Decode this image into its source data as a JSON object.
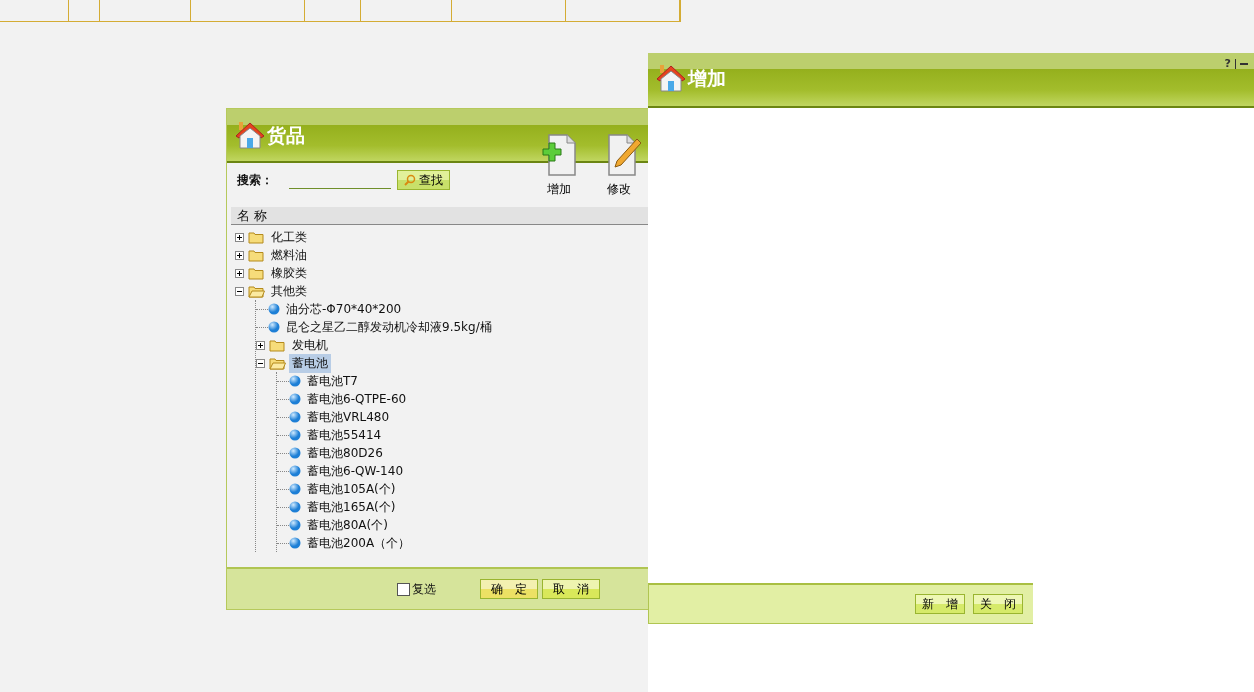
{
  "goods_dialog": {
    "title": "货品",
    "search": {
      "label": "搜索：",
      "button": "查找"
    },
    "toolbar": [
      {
        "label": "增加",
        "kind": "add"
      },
      {
        "label": "修改",
        "kind": "edit"
      }
    ],
    "column": "名 称",
    "tree": [
      {
        "label": "化工类",
        "kind": "folder",
        "expanded": false,
        "selected": false
      },
      {
        "label": "燃料油",
        "kind": "folder",
        "expanded": false,
        "selected": false
      },
      {
        "label": "橡胶类",
        "kind": "folder",
        "expanded": false,
        "selected": false
      },
      {
        "label": "其他类",
        "kind": "folder",
        "expanded": true,
        "selected": false,
        "children": [
          {
            "label": "油分芯-Φ70*40*200",
            "kind": "leaf",
            "selected": false
          },
          {
            "label": "昆仑之星乙二醇发动机冷却液9.5kg/桶",
            "kind": "leaf",
            "selected": false
          },
          {
            "label": "发电机",
            "kind": "folder",
            "expanded": false,
            "selected": false
          },
          {
            "label": "蓄电池",
            "kind": "folder",
            "expanded": true,
            "selected": true,
            "children": [
              {
                "label": "蓄电池T7",
                "kind": "leaf",
                "selected": false
              },
              {
                "label": "蓄电池6-QTPE-60",
                "kind": "leaf",
                "selected": false
              },
              {
                "label": "蓄电池VRL480",
                "kind": "leaf",
                "selected": false
              },
              {
                "label": "蓄电池55414",
                "kind": "leaf",
                "selected": false
              },
              {
                "label": "蓄电池80D26",
                "kind": "leaf",
                "selected": false
              },
              {
                "label": "蓄电池6-QW-140",
                "kind": "leaf",
                "selected": false
              },
              {
                "label": "蓄电池105A(个)",
                "kind": "leaf",
                "selected": false
              },
              {
                "label": "蓄电池165A(个)",
                "kind": "leaf",
                "selected": false
              },
              {
                "label": "蓄电池80A(个)",
                "kind": "leaf",
                "selected": false
              },
              {
                "label": "蓄电池200A（个）",
                "kind": "leaf",
                "selected": false
              }
            ]
          }
        ]
      }
    ],
    "multi_select": {
      "label": "复选",
      "checked": false
    },
    "buttons": [
      {
        "label": "确　定",
        "kind": "primary"
      },
      {
        "label": "取　消",
        "kind": "secondary"
      }
    ]
  },
  "add_window": {
    "title": "增加",
    "help": "?",
    "buttons": [
      {
        "label": "新　增"
      },
      {
        "label": "关　闭"
      }
    ]
  }
}
